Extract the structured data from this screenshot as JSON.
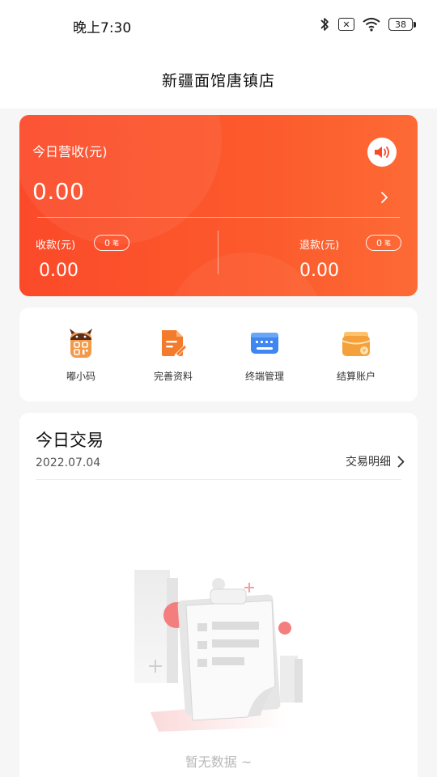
{
  "status_bar": {
    "time": "晚上7:30",
    "sim_icon_text": "✕",
    "battery": "38"
  },
  "header": {
    "title": "新疆面馆唐镇店"
  },
  "revenue": {
    "label": "今日营收(元)",
    "amount": "0.00",
    "speaker_icon": "speaker-icon",
    "collect": {
      "label": "收款(元)",
      "count": "0",
      "count_unit": "笔",
      "amount": "0.00"
    },
    "refund": {
      "label": "退款(元)",
      "count": "0",
      "count_unit": "笔",
      "amount": "0.00"
    }
  },
  "menu": {
    "items": [
      {
        "label": "嘟小码",
        "icon": "qr-mascot-icon"
      },
      {
        "label": "完善资料",
        "icon": "document-edit-icon"
      },
      {
        "label": "终端管理",
        "icon": "keyboard-icon"
      },
      {
        "label": "结算账户",
        "icon": "wallet-icon"
      }
    ]
  },
  "trade": {
    "title": "今日交易",
    "date": "2022.07.04",
    "detail_link": "交易明细",
    "empty_text": "暂无数据 ~"
  },
  "colors": {
    "brand_orange": "#fc5a2c",
    "brand_red": "#fb4a2a",
    "background": "#f6f6f6"
  }
}
